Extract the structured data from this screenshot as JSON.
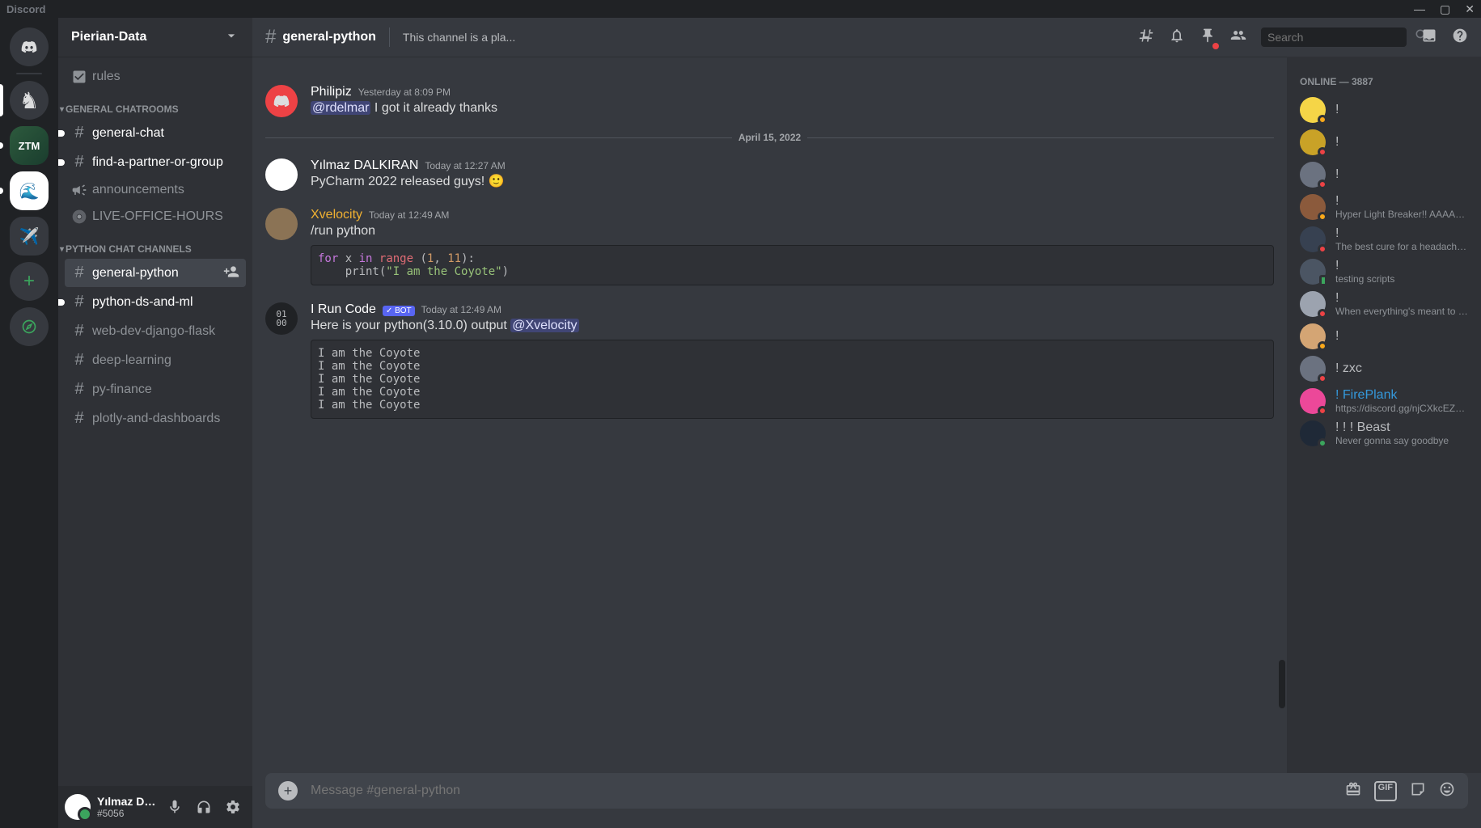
{
  "app_title": "Discord",
  "server": {
    "name": "Pierian-Data"
  },
  "rules_label": "rules",
  "categories": [
    {
      "name": "GENERAL CHATROOMS",
      "channels": [
        {
          "icon": "hash",
          "name": "general-chat",
          "unread": true
        },
        {
          "icon": "hash",
          "name": "find-a-partner-or-group",
          "unread": true
        },
        {
          "icon": "megaphone",
          "name": "announcements"
        },
        {
          "icon": "stage",
          "name": "LIVE-OFFICE-HOURS"
        }
      ]
    },
    {
      "name": "PYTHON CHAT CHANNELS",
      "channels": [
        {
          "icon": "hash",
          "name": "general-python",
          "active": true
        },
        {
          "icon": "hash",
          "name": "python-ds-and-ml",
          "unread": true
        },
        {
          "icon": "hash",
          "name": "web-dev-django-flask"
        },
        {
          "icon": "hash",
          "name": "deep-learning"
        },
        {
          "icon": "hash",
          "name": "py-finance"
        },
        {
          "icon": "hash",
          "name": "plotly-and-dashboards"
        }
      ]
    }
  ],
  "user": {
    "name": "Yılmaz DAL...",
    "tag": "#5056"
  },
  "header": {
    "channel": "general-python",
    "topic": "This channel is a pla..."
  },
  "search_placeholder": "Search",
  "date_divider": "April 15, 2022",
  "messages": [
    {
      "author": "Philipiz",
      "author_color": "#ffffff",
      "time": "Yesterday at 8:09 PM",
      "avatar_bg": "#ed4245",
      "avatar_icon": "discord",
      "text_prefix_mention": "@rdelmar",
      "text": " I got it already thanks"
    },
    {
      "author": "Yılmaz DALKIRAN",
      "author_color": "#ffffff",
      "time": "Today at 12:27 AM",
      "avatar_bg": "#ffffff",
      "text": "PyCharm 2022 released guys! 🙂"
    },
    {
      "author": "Xvelocity",
      "author_color": "#f0b132",
      "time": "Today at 12:49 AM",
      "avatar_bg": "#8b7355",
      "text": "/run python",
      "code": "for x in range (1, 11):\n    print(\"I am the Coyote\")"
    },
    {
      "author": "I Run Code",
      "author_color": "#ffffff",
      "bot": true,
      "bot_label": "BOT",
      "time": "Today at 12:49 AM",
      "avatar_bg": "#202225",
      "avatar_text": "01\n00",
      "text": "Here is your python(3.10.0) output ",
      "text_suffix_mention": "@Xvelocity",
      "output": "I am the Coyote\nI am the Coyote\nI am the Coyote\nI am the Coyote\nI am the Coyote"
    }
  ],
  "input_placeholder": "Message #general-python",
  "members": {
    "header": "ONLINE — 3887",
    "list": [
      {
        "name": "!",
        "avatar_bg": "#f5d547",
        "status": "idle"
      },
      {
        "name": "!",
        "avatar_bg": "#c9a227",
        "status": "dnd"
      },
      {
        "name": "!",
        "avatar_bg": "#6b7280",
        "status": "dnd"
      },
      {
        "name": "!",
        "activity": "Hyper Light Breaker!! AAAAH...",
        "avatar_bg": "#8b5a3c",
        "status": "idle"
      },
      {
        "name": "!",
        "activity": "The best cure for a headache i...",
        "avatar_bg": "#374151",
        "status": "dnd"
      },
      {
        "name": "!",
        "activity": "testing scripts",
        "avatar_bg": "#4b5563",
        "status": "mobile"
      },
      {
        "name": "!",
        "activity": "When everything's meant to b...",
        "avatar_bg": "#9ca3af",
        "status": "dnd"
      },
      {
        "name": "!",
        "avatar_bg": "#d4a574",
        "status": "idle"
      },
      {
        "name": "! zxc",
        "avatar_bg": "#6b7280",
        "status": "dnd"
      },
      {
        "name": "! FirePlank",
        "name_color": "#3498db",
        "activity": "https://discord.gg/njCXkcEZqQ",
        "avatar_bg": "#ec4899",
        "status": "dnd"
      },
      {
        "name": "! ! ! Beast",
        "activity": "Never gonna say goodbye",
        "avatar_bg": "#1f2937",
        "status": "online"
      }
    ]
  }
}
